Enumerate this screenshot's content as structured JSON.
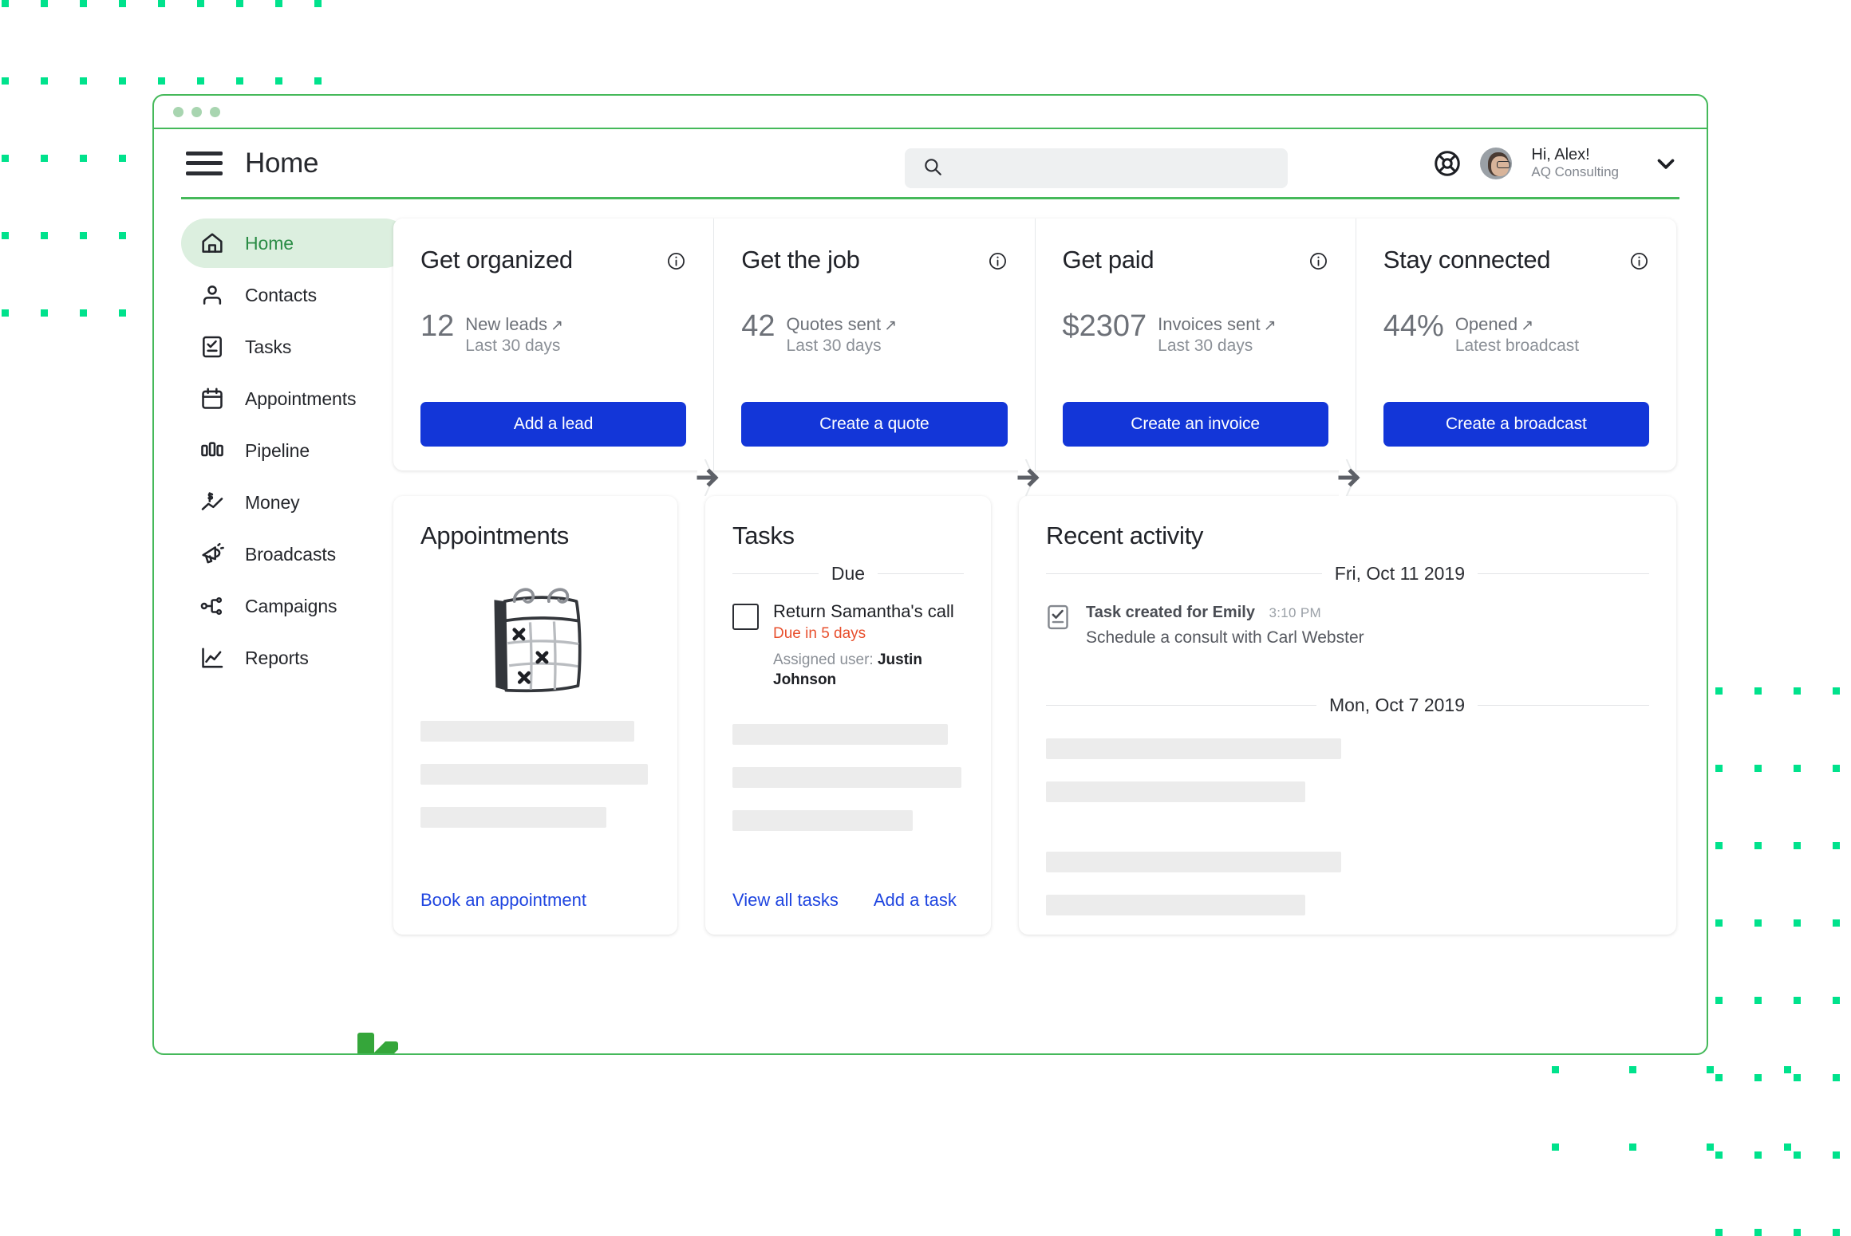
{
  "window": {
    "traffic_dots": 3,
    "border_color": "#45b95a"
  },
  "appbar": {
    "title": "Home",
    "menu_label": "Menu",
    "search": {
      "value": "",
      "placeholder": ""
    },
    "help_label": "Help",
    "user": {
      "greeting": "Hi, Alex!",
      "org": "AQ Consulting"
    }
  },
  "sidebar": {
    "items": [
      {
        "label": "Home",
        "icon": "home-icon",
        "active": true
      },
      {
        "label": "Contacts",
        "icon": "contacts-icon",
        "active": false
      },
      {
        "label": "Tasks",
        "icon": "tasks-icon",
        "active": false
      },
      {
        "label": "Appointments",
        "icon": "calendar-icon",
        "active": false
      },
      {
        "label": "Pipeline",
        "icon": "pipeline-icon",
        "active": false
      },
      {
        "label": "Money",
        "icon": "money-icon",
        "active": false
      },
      {
        "label": "Broadcasts",
        "icon": "megaphone-icon",
        "active": false
      },
      {
        "label": "Campaigns",
        "icon": "campaigns-icon",
        "active": false
      },
      {
        "label": "Reports",
        "icon": "reports-icon",
        "active": false
      }
    ],
    "logo": "keap-logo"
  },
  "kpi_cards": [
    {
      "title": "Get organized",
      "value": "12",
      "metric": "New leads",
      "period": "Last 30 days",
      "button": "Add a lead"
    },
    {
      "title": "Get the job",
      "value": "42",
      "metric": "Quotes sent",
      "period": "Last 30 days",
      "button": "Create a quote"
    },
    {
      "title": "Get paid",
      "value": "$2307",
      "metric": "Invoices sent",
      "period": "Last 30 days",
      "button": "Create an invoice"
    },
    {
      "title": "Stay connected",
      "value": "44%",
      "metric": "Opened",
      "period": "Latest broadcast",
      "button": "Create a broadcast"
    }
  ],
  "appointments_card": {
    "title": "Appointments",
    "illustration": "calendar-illustration",
    "link": "Book an appointment"
  },
  "tasks_card": {
    "title": "Tasks",
    "group_label": "Due",
    "task": {
      "name": "Return Samantha's call",
      "due": "Due in 5 days",
      "assigned_prefix": "Assigned user:",
      "assigned_user": "Justin Johnson",
      "checked": false
    },
    "links": [
      "View all tasks",
      "Add a task"
    ]
  },
  "activity_card": {
    "title": "Recent activity",
    "groups": [
      {
        "date": "Fri, Oct 11 2019",
        "entries": [
          {
            "icon": "task-icon",
            "headline": "Task created for Emily",
            "time": "3:10 PM",
            "detail": "Schedule a consult with Carl Webster"
          }
        ]
      },
      {
        "date": "Mon, Oct 7 2019",
        "entries": []
      }
    ]
  },
  "colors": {
    "accent_green": "#45b95a",
    "dot_green": "#00E28C",
    "primary_blue": "#1336d8",
    "link_blue": "#1f45e0",
    "due_red": "#e8502e",
    "active_nav_bg": "#dcefdf",
    "active_nav_text": "#2a8c45"
  }
}
